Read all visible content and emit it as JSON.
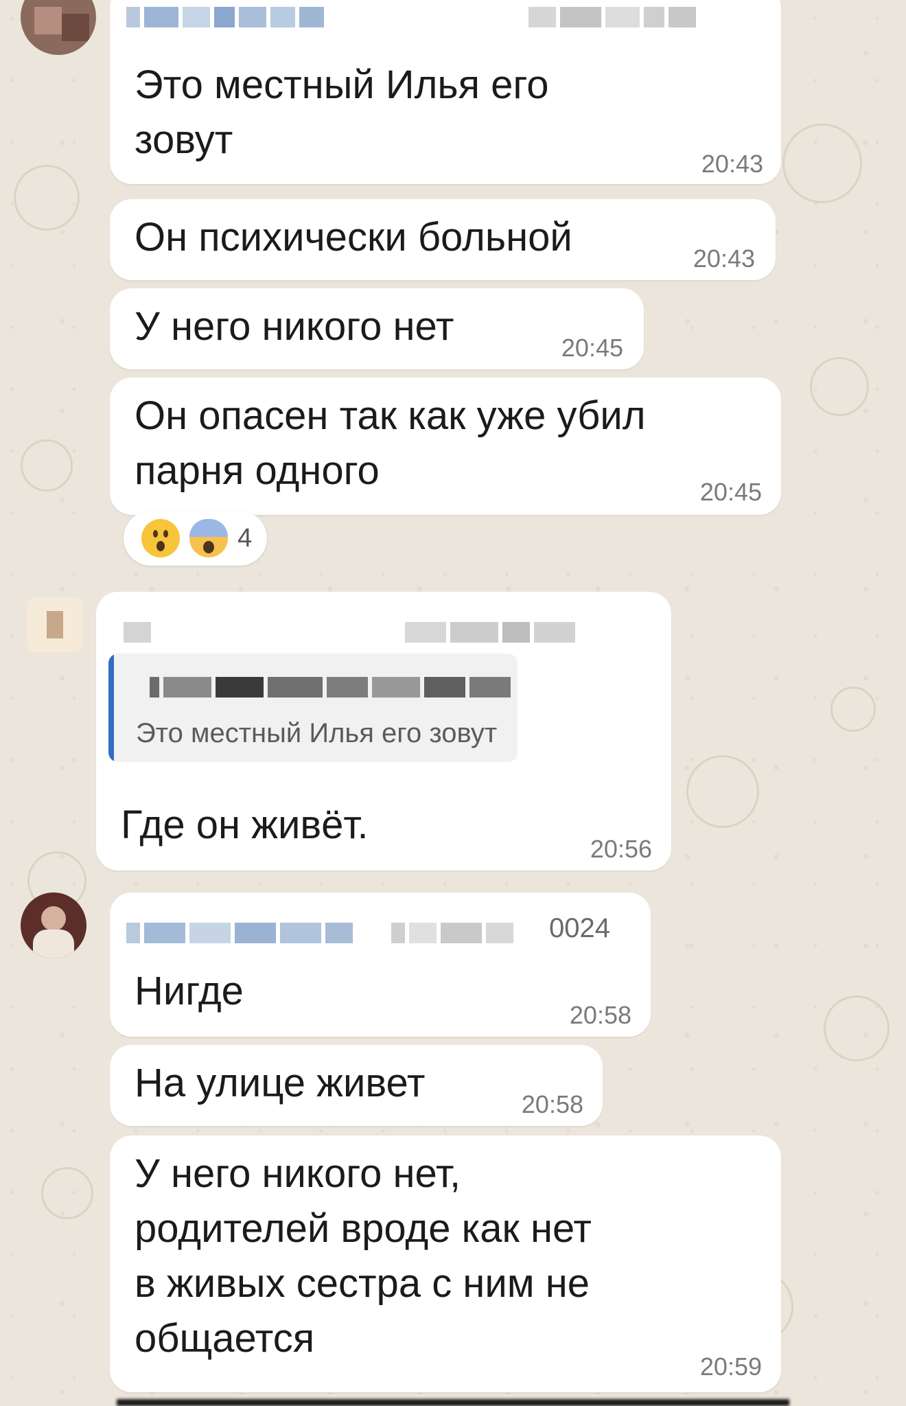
{
  "chat": {
    "messages": [
      {
        "text_lines": [
          "Это местный Илья его",
          "зовут"
        ],
        "time": "20:43"
      },
      {
        "text_lines": [
          "Он психически больной"
        ],
        "time": "20:43"
      },
      {
        "text_lines": [
          "У него никого нет"
        ],
        "time": "20:45"
      },
      {
        "text_lines": [
          "Он опасен так как уже убил",
          "парня одного"
        ],
        "time": "20:45",
        "reactions": {
          "emojis": [
            "surprised-face",
            "screaming-face"
          ],
          "count": "4"
        }
      },
      {
        "reply_quote": "Это местный Илья его зовут",
        "text_lines": [
          "Где он живёт."
        ],
        "time": "20:56"
      },
      {
        "sender_suffix": "0024",
        "text_lines": [
          "Нигде"
        ],
        "time": "20:58"
      },
      {
        "text_lines": [
          "На улице живет"
        ],
        "time": "20:58"
      },
      {
        "text_lines": [
          "У него никого нет,",
          "родителей вроде как нет",
          "в живых сестра с ним не",
          "общается"
        ],
        "time": "20:59"
      }
    ]
  },
  "colors": {
    "background": "#ece5db",
    "bubble": "#ffffff",
    "quote_accent": "#2f6fc4",
    "time_text": "#7a7a7a"
  }
}
